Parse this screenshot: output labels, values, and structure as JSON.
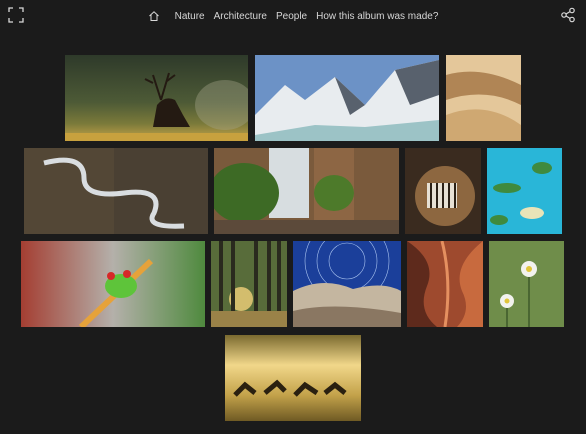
{
  "nav": {
    "items": [
      "Nature",
      "Architecture",
      "People",
      "How this album was made?"
    ]
  },
  "icons": {
    "fullscreen": "fullscreen-icon",
    "home": "home-icon",
    "share": "share-icon"
  },
  "colors": {
    "background": "#1b1b1b",
    "nav_text": "#d6d6d6"
  },
  "gallery": {
    "photos": [
      "deer-stag-in-misty-field",
      "snowy-mountains-and-lake",
      "desert-sand-dunes",
      "winding-river-aerial",
      "waterfall-with-ferns",
      "zebra-in-dust",
      "tropical-islands-aerial",
      "red-eyed-tree-frog",
      "sunlit-forest-path",
      "star-trails-over-rocks",
      "antelope-canyon",
      "white-daisies",
      "deer-herd-at-sunset"
    ]
  }
}
